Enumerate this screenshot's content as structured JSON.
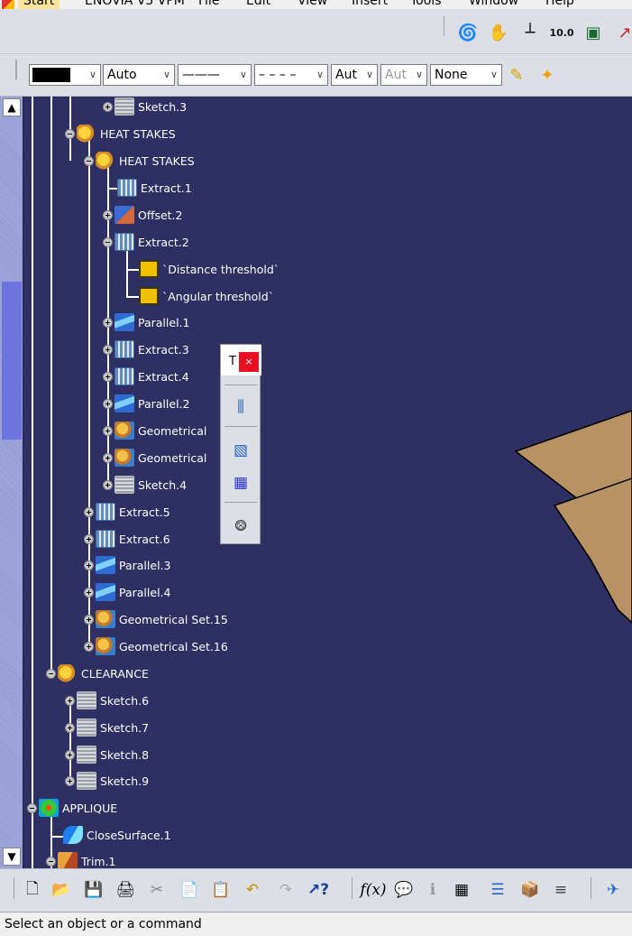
{
  "menubar": {
    "items": [
      "Start",
      "ENOVIA V5 VPM",
      "File",
      "Edit",
      "View",
      "Insert",
      "Tools",
      "Window",
      "Help"
    ]
  },
  "top_toolbar": {
    "icons": [
      "swirl-icon",
      "hand-pan-icon",
      "axis-icon",
      "scale-10-icon",
      "cube-stack-icon",
      "red-axis-icon"
    ]
  },
  "properties_toolbar": {
    "color_swatch": "#000000",
    "fill_value": "Auto",
    "line_style": "———",
    "dash_style": "– – – –",
    "thickness_value": "Aut",
    "point_value": "Aut",
    "layer_value": "None"
  },
  "tree": {
    "nodes": [
      {
        "label": "Sketch.3",
        "icon": "sketch"
      },
      {
        "label": "HEAT STAKES",
        "icon": "set"
      },
      {
        "label": "HEAT STAKES",
        "icon": "set"
      },
      {
        "label": "Extract.1",
        "icon": "extract"
      },
      {
        "label": "Offset.2",
        "icon": "offset"
      },
      {
        "label": "Extract.2",
        "icon": "extract"
      },
      {
        "label": "`Distance threshold`",
        "icon": "param"
      },
      {
        "label": "`Angular threshold`",
        "icon": "param"
      },
      {
        "label": "Parallel.1",
        "icon": "parallel"
      },
      {
        "label": "Extract.3",
        "icon": "extract"
      },
      {
        "label": "Extract.4",
        "icon": "extract"
      },
      {
        "label": "Parallel.2",
        "icon": "parallel"
      },
      {
        "label": "Geometrical",
        "icon": "geoset"
      },
      {
        "label": "Geometrical",
        "icon": "geoset"
      },
      {
        "label": "Sketch.4",
        "icon": "sketch"
      },
      {
        "label": "Extract.5",
        "icon": "extract"
      },
      {
        "label": "Extract.6",
        "icon": "extract"
      },
      {
        "label": "Parallel.3",
        "icon": "parallel"
      },
      {
        "label": "Parallel.4",
        "icon": "parallel"
      },
      {
        "label": "Geometrical Set.15",
        "icon": "geoset"
      },
      {
        "label": "Geometrical Set.16",
        "icon": "geoset"
      },
      {
        "label": "CLEARANCE",
        "icon": "set"
      },
      {
        "label": "Sketch.6",
        "icon": "sketch"
      },
      {
        "label": "Sketch.7",
        "icon": "sketch"
      },
      {
        "label": "Sketch.8",
        "icon": "sketch"
      },
      {
        "label": "Sketch.9",
        "icon": "sketch"
      },
      {
        "label": "APPLIQUE",
        "icon": "appl"
      },
      {
        "label": "CloseSurface.1",
        "icon": "close"
      },
      {
        "label": "Trim.1",
        "icon": "trim"
      }
    ]
  },
  "floating_toolbar": {
    "title": "T",
    "close_label": "×",
    "icons": [
      "cylinders-icon",
      "multi-surface-icon",
      "grid-icon",
      "node-icon"
    ]
  },
  "bottom_toolbar": {
    "icons": [
      "new-file-icon",
      "open-folder-icon",
      "save-icon",
      "print-icon",
      "cut-icon",
      "copy-icon",
      "paste-icon",
      "undo-icon",
      "redo-icon",
      "whats-this-icon",
      "formula-icon",
      "comment-icon",
      "info-icon",
      "table-icon",
      "tree-icon",
      "catalog-icon",
      "list-icon",
      "sketch-plane-icon"
    ]
  },
  "status": {
    "text": "Select an object or a command"
  }
}
